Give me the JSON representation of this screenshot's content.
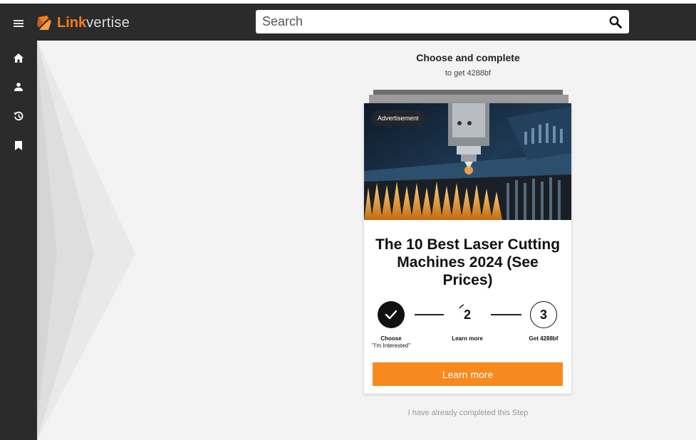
{
  "header": {
    "logo_bold": "Link",
    "logo_light": "vertise",
    "search": {
      "placeholder": "Search",
      "value": ""
    }
  },
  "sidebar": {
    "items": [
      {
        "icon": "home-icon"
      },
      {
        "icon": "user-icon"
      },
      {
        "icon": "history-icon"
      },
      {
        "icon": "bookmark-icon"
      }
    ]
  },
  "main": {
    "heading": "Choose and complete",
    "subheading": "to get 4288bf",
    "ad": {
      "badge": "Advertisement",
      "title": "The 10 Best Laser Cutting Machines 2024 (See Prices)"
    },
    "steps": [
      {
        "number": "",
        "label_line1": "Choose",
        "label_line2": "\"I'm Interested\"",
        "state": "done"
      },
      {
        "number": "2",
        "label_line1": "Learn more",
        "label_line2": "",
        "state": "active"
      },
      {
        "number": "3",
        "label_line1": "Get 4288bf",
        "label_line2": "",
        "state": "pending"
      }
    ],
    "cta_label": "Learn more",
    "skip_text": "I have already completed this Step"
  },
  "colors": {
    "accent": "#f7891f",
    "topbar": "#2b2b2b",
    "background": "#f3f3f3"
  }
}
